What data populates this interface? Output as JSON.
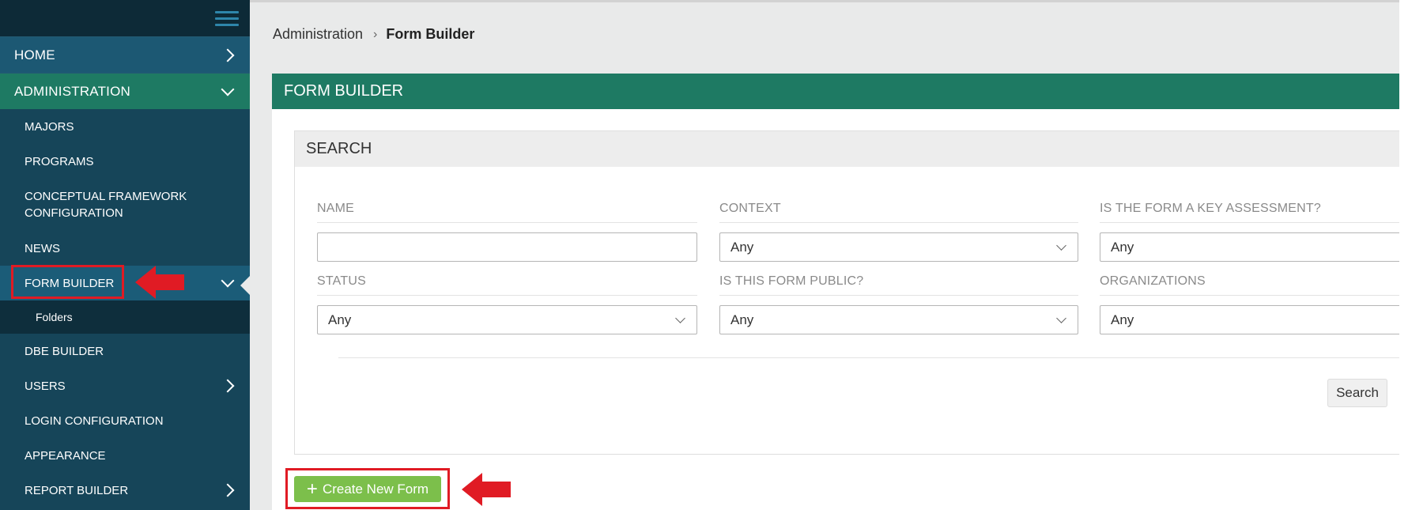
{
  "sidebar": {
    "menu_icon": "hamburger-icon",
    "home_label": "HOME",
    "administration_label": "ADMINISTRATION",
    "items": [
      {
        "label": "MAJORS"
      },
      {
        "label": "PROGRAMS"
      },
      {
        "label": "CONCEPTUAL FRAMEWORK CONFIGURATION"
      },
      {
        "label": "NEWS"
      },
      {
        "label": "FORM BUILDER"
      },
      {
        "label": "Folders"
      },
      {
        "label": "DBE BUILDER"
      },
      {
        "label": "USERS"
      },
      {
        "label": "LOGIN CONFIGURATION"
      },
      {
        "label": "APPEARANCE"
      },
      {
        "label": "REPORT BUILDER"
      }
    ]
  },
  "breadcrumb": {
    "parent": "Administration",
    "current": "Form Builder"
  },
  "panel": {
    "title": "FORM BUILDER"
  },
  "search": {
    "title": "SEARCH",
    "fields": {
      "name": {
        "label": "NAME",
        "value": ""
      },
      "context": {
        "label": "CONTEXT",
        "value": "Any"
      },
      "key_assessment": {
        "label": "IS THE FORM A KEY ASSESSMENT?",
        "value": "Any"
      },
      "status": {
        "label": "STATUS",
        "value": "Any"
      },
      "public": {
        "label": "IS THIS FORM PUBLIC?",
        "value": "Any"
      },
      "organizations": {
        "label": "ORGANIZATIONS",
        "value": "Any"
      }
    },
    "search_button": "Search"
  },
  "create_button": {
    "icon": "plus-icon",
    "label": "Create New Form"
  },
  "annotations": {
    "highlight_color": "#e01b24"
  },
  "colors": {
    "sidebar_bg": "#164559",
    "admin_green": "#1e7a63",
    "create_green": "#7cbf4b"
  }
}
